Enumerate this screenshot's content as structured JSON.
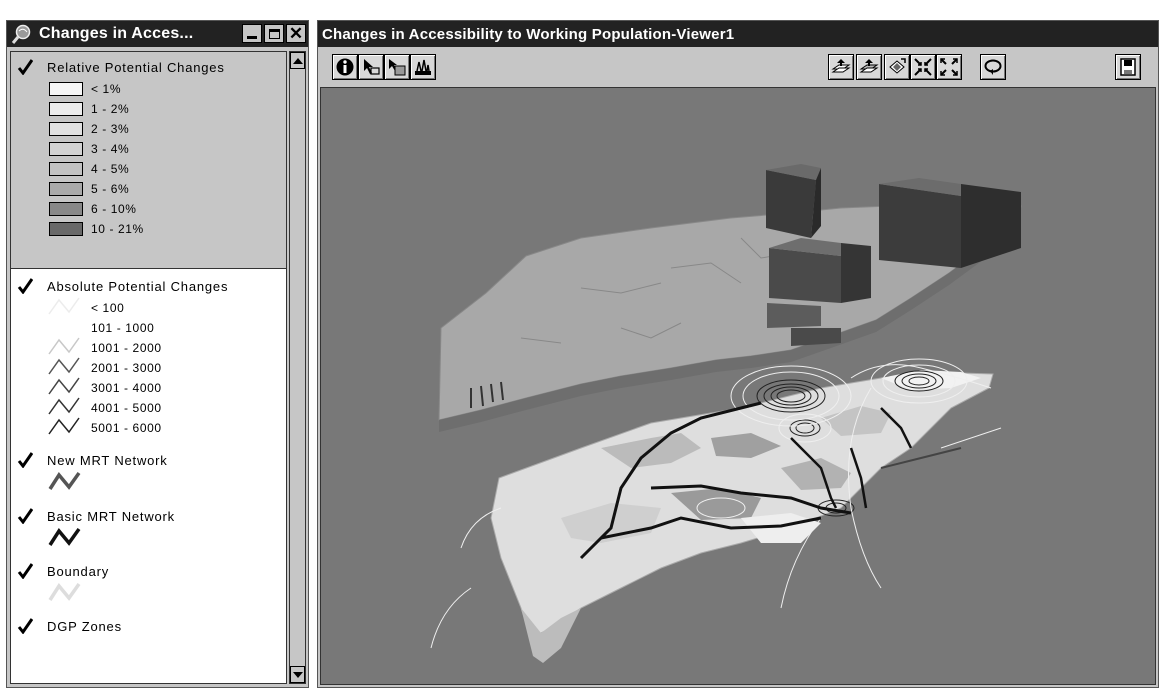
{
  "legend_window": {
    "title": "Changes in Acces...",
    "layers": [
      {
        "name": "Relative Potential Changes",
        "checked": true,
        "classes": [
          {
            "label": "< 1%",
            "color": "#f6f6f6"
          },
          {
            "label": "1 - 2%",
            "color": "#ececec"
          },
          {
            "label": "2 - 3%",
            "color": "#e0e0e0"
          },
          {
            "label": "3 - 4%",
            "color": "#d2d2d2"
          },
          {
            "label": "4 - 5%",
            "color": "#c2c2c2"
          },
          {
            "label": "5 - 6%",
            "color": "#aaaaaa"
          },
          {
            "label": "6 - 10%",
            "color": "#888888"
          },
          {
            "label": "10 - 21%",
            "color": "#686868"
          }
        ]
      },
      {
        "name": "Absolute Potential Changes",
        "checked": true,
        "classes": [
          {
            "label": "< 100",
            "color": "#ececec"
          },
          {
            "label": "101 - 1000",
            "color": "#ffffff"
          },
          {
            "label": "1001 - 2000",
            "color": "#c8c8c8"
          },
          {
            "label": "2001 - 3000",
            "color": "#555555"
          },
          {
            "label": "3001 - 4000",
            "color": "#444444"
          },
          {
            "label": "4001 - 5000",
            "color": "#333333"
          },
          {
            "label": "5001 - 6000",
            "color": "#222222"
          }
        ]
      },
      {
        "name": "New MRT Network",
        "checked": true,
        "line_color": "#555555"
      },
      {
        "name": "Basic MRT Network",
        "checked": true,
        "line_color": "#111111"
      },
      {
        "name": "Boundary",
        "checked": true,
        "line_color": "#dddddd"
      },
      {
        "name": "DGP Zones",
        "checked": true
      }
    ]
  },
  "viewer_window": {
    "title": "Changes in Accessibility to Working Population-Viewer1",
    "toolbar_left": [
      "info-icon",
      "select-pointer-icon",
      "select-features-icon",
      "navigate-3d-icon"
    ],
    "toolbar_right": [
      "zoom-to-active-themes-icon",
      "zoom-to-selected-icon",
      "zoom-full-extent-icon",
      "zoom-in-icon",
      "zoom-out-icon",
      "rotate-view-icon",
      "save-view-icon"
    ]
  },
  "colors": {
    "title_bar": "#222222",
    "window_chrome": "#c6c6c6",
    "map_background": "#787878"
  }
}
